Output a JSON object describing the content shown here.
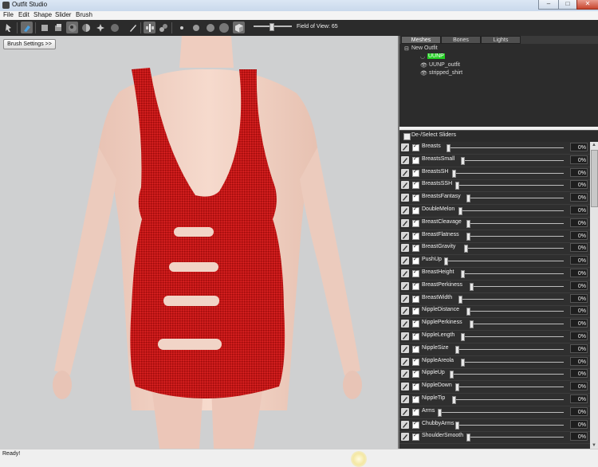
{
  "window": {
    "title": "Outfit Studio"
  },
  "menu": [
    "File",
    "Edit",
    "Shape",
    "Slider",
    "Brush"
  ],
  "toolbar": {
    "buttons": [
      "select-tool-icon",
      "brush-tool-icon",
      "mask-brush-icon",
      "inflate-brush-icon",
      "deflate-brush-icon",
      "move-brush-icon",
      "smooth-brush-icon",
      "weight-brush-icon",
      "undo-brush-icon",
      "color-picker-icon",
      "mirror-toggle-icon",
      "connected-toggle-icon",
      "brush-size-xs-icon",
      "brush-size-s-icon",
      "brush-size-m-icon",
      "brush-size-l-icon",
      "cube-view-icon"
    ],
    "field_of_view_label": "Field of View: 65",
    "field_of_view": 65
  },
  "viewport": {
    "brush_settings_label": "Brush Settings >>"
  },
  "tabs": [
    "Meshes",
    "Bones",
    "Lights"
  ],
  "tree": {
    "root": "New Outfit",
    "items": [
      "UUNP",
      "UUNP_outfit",
      "stripped_shirt"
    ]
  },
  "sliders_header": "De-/Select Sliders",
  "sliders": [
    {
      "name": "Breasts",
      "value": "0%",
      "pos": 0.0
    },
    {
      "name": "BreastsSmall",
      "value": "0%",
      "pos": 0.0
    },
    {
      "name": "BreastsSH",
      "value": "0%",
      "pos": 0.0
    },
    {
      "name": "BreastsSSH",
      "value": "0%",
      "pos": 0.0
    },
    {
      "name": "BreastsFantasy",
      "value": "0%",
      "pos": 0.0
    },
    {
      "name": "DoubleMelon",
      "value": "0%",
      "pos": 0.0
    },
    {
      "name": "BreastCleavage",
      "value": "0%",
      "pos": 0.0
    },
    {
      "name": "BreastFlatness",
      "value": "0%",
      "pos": 0.0
    },
    {
      "name": "BreastGravity",
      "value": "0%",
      "pos": 0.0
    },
    {
      "name": "PushUp",
      "value": "0%",
      "pos": 0.0
    },
    {
      "name": "BreastHeight",
      "value": "0%",
      "pos": 0.0
    },
    {
      "name": "BreastPerkiness",
      "value": "0%",
      "pos": 0.0
    },
    {
      "name": "BreastWidth",
      "value": "0%",
      "pos": 0.0
    },
    {
      "name": "NippleDistance",
      "value": "0%",
      "pos": 0.0
    },
    {
      "name": "NipplePerkiness",
      "value": "0%",
      "pos": 0.0
    },
    {
      "name": "NippleLength",
      "value": "0%",
      "pos": 0.0
    },
    {
      "name": "NippleSize",
      "value": "0%",
      "pos": 0.0
    },
    {
      "name": "NippleAreola",
      "value": "0%",
      "pos": 0.0
    },
    {
      "name": "NippleUp",
      "value": "0%",
      "pos": 0.0
    },
    {
      "name": "NippleDown",
      "value": "0%",
      "pos": 0.0
    },
    {
      "name": "NippleTip",
      "value": "0%",
      "pos": 0.0
    },
    {
      "name": "Arms",
      "value": "0%",
      "pos": 0.0
    },
    {
      "name": "ChubbyArms",
      "value": "0%",
      "pos": 0.0
    },
    {
      "name": "ShoulderSmooth",
      "value": "0%",
      "pos": 0.0
    }
  ],
  "status": "Ready!",
  "colors": {
    "dress": "#c41414",
    "skin": "#f2d3c6",
    "panel": "#2f2f2f",
    "mesh_highlight": "#22dd22"
  }
}
